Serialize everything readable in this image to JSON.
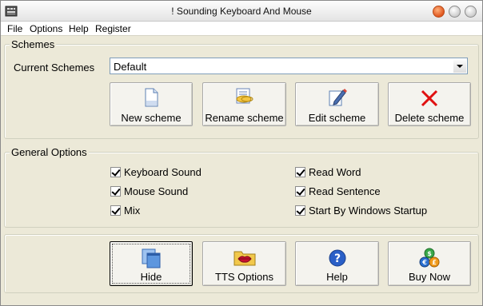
{
  "window": {
    "title": "! Sounding Keyboard And Mouse"
  },
  "menu": [
    "File",
    "Options",
    "Help",
    "Register"
  ],
  "schemes": {
    "legend": "Schemes",
    "current_label": "Current Schemes",
    "current_value": "Default",
    "buttons": {
      "new": "New scheme",
      "rename": "Rename scheme",
      "edit": "Edit scheme",
      "delete": "Delete scheme"
    }
  },
  "general": {
    "legend": "General Options",
    "options": [
      {
        "label": "Keyboard Sound",
        "checked": true
      },
      {
        "label": "Mouse Sound",
        "checked": true
      },
      {
        "label": "Mix",
        "checked": true
      },
      {
        "label": "Read Word",
        "checked": true
      },
      {
        "label": "Read Sentence",
        "checked": true
      },
      {
        "label": "Start By Windows Startup",
        "checked": true
      }
    ]
  },
  "actions": {
    "hide": "Hide",
    "tts": "TTS Options",
    "help": "Help",
    "buy": "Buy Now"
  },
  "colors": {
    "delete_icon": "#e01010",
    "help_icon": "#2a5fc7"
  }
}
